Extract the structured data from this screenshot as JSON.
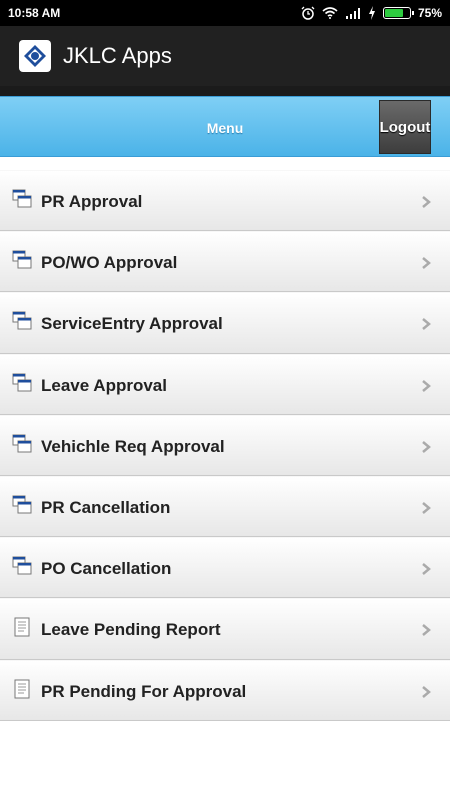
{
  "status_bar": {
    "time": "10:58 AM",
    "battery_percent": "75%",
    "battery_level": 0.75
  },
  "app_bar": {
    "title": "JKLC Apps"
  },
  "menu_bar": {
    "title": "Menu",
    "logout_label": "Logout"
  },
  "menu_items": [
    {
      "label": "PR Approval",
      "icon": "windows-icon"
    },
    {
      "label": "PO/WO Approval",
      "icon": "windows-icon"
    },
    {
      "label": "ServiceEntry Approval",
      "icon": "windows-icon"
    },
    {
      "label": "Leave Approval",
      "icon": "windows-icon"
    },
    {
      "label": "Vehichle Req Approval",
      "icon": "windows-icon"
    },
    {
      "label": "PR Cancellation",
      "icon": "windows-icon"
    },
    {
      "label": "PO Cancellation",
      "icon": "windows-icon"
    },
    {
      "label": "Leave Pending Report",
      "icon": "document-icon"
    },
    {
      "label": "PR Pending For Approval",
      "icon": "document-icon"
    }
  ],
  "colors": {
    "menu_bar": "#4bb3e8",
    "app_bar": "#212121",
    "battery": "#2ecc40",
    "icon_blue": "#1f4e9c"
  }
}
